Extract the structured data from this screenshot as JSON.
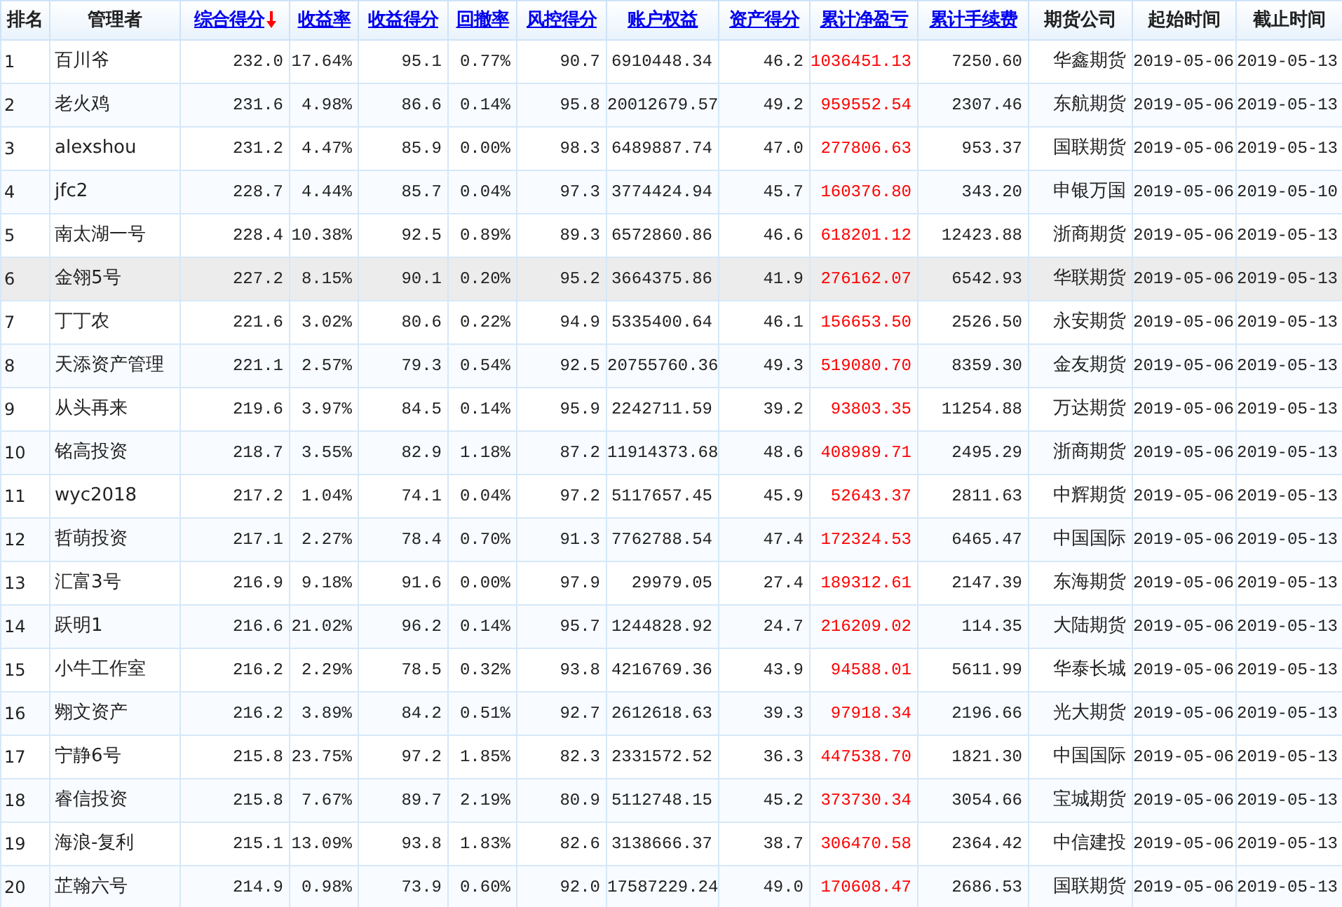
{
  "table": {
    "columns": [
      {
        "label": "排名",
        "link": false,
        "sorted": false,
        "kind": "rank"
      },
      {
        "label": "管理者",
        "link": false,
        "sorted": false,
        "kind": "name"
      },
      {
        "label": "综合得分",
        "link": true,
        "sorted": true,
        "kind": "number"
      },
      {
        "label": "收益率",
        "link": true,
        "sorted": false,
        "kind": "number"
      },
      {
        "label": "收益得分",
        "link": true,
        "sorted": false,
        "kind": "number"
      },
      {
        "label": "回撤率",
        "link": true,
        "sorted": false,
        "kind": "number"
      },
      {
        "label": "风控得分",
        "link": true,
        "sorted": false,
        "kind": "number"
      },
      {
        "label": "账户权益",
        "link": true,
        "sorted": false,
        "kind": "number"
      },
      {
        "label": "资产得分",
        "link": true,
        "sorted": false,
        "kind": "number"
      },
      {
        "label": "累计净盈亏",
        "link": true,
        "sorted": false,
        "kind": "profit"
      },
      {
        "label": "累计手续费",
        "link": true,
        "sorted": false,
        "kind": "number"
      },
      {
        "label": "期货公司",
        "link": false,
        "sorted": false,
        "kind": "company"
      },
      {
        "label": "起始时间",
        "link": false,
        "sorted": false,
        "kind": "date"
      },
      {
        "label": "截止时间",
        "link": false,
        "sorted": false,
        "kind": "date"
      }
    ],
    "rows": [
      {
        "selected": false,
        "cells": [
          "1",
          "百川爷",
          "232.0",
          "17.64%",
          "95.1",
          "0.77%",
          "90.7",
          "6910448.34",
          "46.2",
          "1036451.13",
          "7250.60",
          "华鑫期货",
          "2019-05-06",
          "2019-05-13"
        ]
      },
      {
        "selected": false,
        "cells": [
          "2",
          "老火鸡",
          "231.6",
          "4.98%",
          "86.6",
          "0.14%",
          "95.8",
          "20012679.57",
          "49.2",
          "959552.54",
          "2307.46",
          "东航期货",
          "2019-05-06",
          "2019-05-13"
        ]
      },
      {
        "selected": false,
        "cells": [
          "3",
          "alexshou",
          "231.2",
          "4.47%",
          "85.9",
          "0.00%",
          "98.3",
          "6489887.74",
          "47.0",
          "277806.63",
          "953.37",
          "国联期货",
          "2019-05-06",
          "2019-05-13"
        ]
      },
      {
        "selected": false,
        "cells": [
          "4",
          "jfc2",
          "228.7",
          "4.44%",
          "85.7",
          "0.04%",
          "97.3",
          "3774424.94",
          "45.7",
          "160376.80",
          "343.20",
          "申银万国",
          "2019-05-06",
          "2019-05-10"
        ]
      },
      {
        "selected": false,
        "cells": [
          "5",
          "南太湖一号",
          "228.4",
          "10.38%",
          "92.5",
          "0.89%",
          "89.3",
          "6572860.86",
          "46.6",
          "618201.12",
          "12423.88",
          "浙商期货",
          "2019-05-06",
          "2019-05-13"
        ]
      },
      {
        "selected": true,
        "cells": [
          "6",
          "金翎5号",
          "227.2",
          "8.15%",
          "90.1",
          "0.20%",
          "95.2",
          "3664375.86",
          "41.9",
          "276162.07",
          "6542.93",
          "华联期货",
          "2019-05-06",
          "2019-05-13"
        ]
      },
      {
        "selected": false,
        "cells": [
          "7",
          "丁丁农",
          "221.6",
          "3.02%",
          "80.6",
          "0.22%",
          "94.9",
          "5335400.64",
          "46.1",
          "156653.50",
          "2526.50",
          "永安期货",
          "2019-05-06",
          "2019-05-13"
        ]
      },
      {
        "selected": false,
        "cells": [
          "8",
          "天添资产管理",
          "221.1",
          "2.57%",
          "79.3",
          "0.54%",
          "92.5",
          "20755760.36",
          "49.3",
          "519080.70",
          "8359.30",
          "金友期货",
          "2019-05-06",
          "2019-05-13"
        ]
      },
      {
        "selected": false,
        "cells": [
          "9",
          "从头再来",
          "219.6",
          "3.97%",
          "84.5",
          "0.14%",
          "95.9",
          "2242711.59",
          "39.2",
          "93803.35",
          "11254.88",
          "万达期货",
          "2019-05-06",
          "2019-05-13"
        ]
      },
      {
        "selected": false,
        "cells": [
          "10",
          "铭高投资",
          "218.7",
          "3.55%",
          "82.9",
          "1.18%",
          "87.2",
          "11914373.68",
          "48.6",
          "408989.71",
          "2495.29",
          "浙商期货",
          "2019-05-06",
          "2019-05-13"
        ]
      },
      {
        "selected": false,
        "cells": [
          "11",
          "wyc2018",
          "217.2",
          "1.04%",
          "74.1",
          "0.04%",
          "97.2",
          "5117657.45",
          "45.9",
          "52643.37",
          "2811.63",
          "中辉期货",
          "2019-05-06",
          "2019-05-13"
        ]
      },
      {
        "selected": false,
        "cells": [
          "12",
          "哲萌投资",
          "217.1",
          "2.27%",
          "78.4",
          "0.70%",
          "91.3",
          "7762788.54",
          "47.4",
          "172324.53",
          "6465.47",
          "中国国际",
          "2019-05-06",
          "2019-05-13"
        ]
      },
      {
        "selected": false,
        "cells": [
          "13",
          "汇富3号",
          "216.9",
          "9.18%",
          "91.6",
          "0.00%",
          "97.9",
          "29979.05",
          "27.4",
          "189312.61",
          "2147.39",
          "东海期货",
          "2019-05-06",
          "2019-05-13"
        ]
      },
      {
        "selected": false,
        "cells": [
          "14",
          "跃明1",
          "216.6",
          "21.02%",
          "96.2",
          "0.14%",
          "95.7",
          "1244828.92",
          "24.7",
          "216209.02",
          "114.35",
          "大陆期货",
          "2019-05-06",
          "2019-05-13"
        ]
      },
      {
        "selected": false,
        "cells": [
          "15",
          "小牛工作室",
          "216.2",
          "2.29%",
          "78.5",
          "0.32%",
          "93.8",
          "4216769.36",
          "43.9",
          "94588.01",
          "5611.99",
          "华泰长城",
          "2019-05-06",
          "2019-05-13"
        ]
      },
      {
        "selected": false,
        "cells": [
          "16",
          "翙文资产",
          "216.2",
          "3.89%",
          "84.2",
          "0.51%",
          "92.7",
          "2612618.63",
          "39.3",
          "97918.34",
          "2196.66",
          "光大期货",
          "2019-05-06",
          "2019-05-13"
        ]
      },
      {
        "selected": false,
        "cells": [
          "17",
          "宁静6号",
          "215.8",
          "23.75%",
          "97.2",
          "1.85%",
          "82.3",
          "2331572.52",
          "36.3",
          "447538.70",
          "1821.30",
          "中国国际",
          "2019-05-06",
          "2019-05-13"
        ]
      },
      {
        "selected": false,
        "cells": [
          "18",
          "睿信投资",
          "215.8",
          "7.67%",
          "89.7",
          "2.19%",
          "80.9",
          "5112748.15",
          "45.2",
          "373730.34",
          "3054.66",
          "宝城期货",
          "2019-05-06",
          "2019-05-13"
        ]
      },
      {
        "selected": false,
        "cells": [
          "19",
          "海浪-复利",
          "215.1",
          "13.09%",
          "93.8",
          "1.83%",
          "82.6",
          "3138666.37",
          "38.7",
          "306470.58",
          "2364.42",
          "中信建投",
          "2019-05-06",
          "2019-05-13"
        ]
      },
      {
        "selected": false,
        "cells": [
          "20",
          "芷翰六号",
          "214.9",
          "0.98%",
          "73.9",
          "0.60%",
          "92.0",
          "17587229.24",
          "49.0",
          "170608.47",
          "2686.53",
          "国联期货",
          "2019-05-06",
          "2019-05-13"
        ]
      }
    ]
  }
}
